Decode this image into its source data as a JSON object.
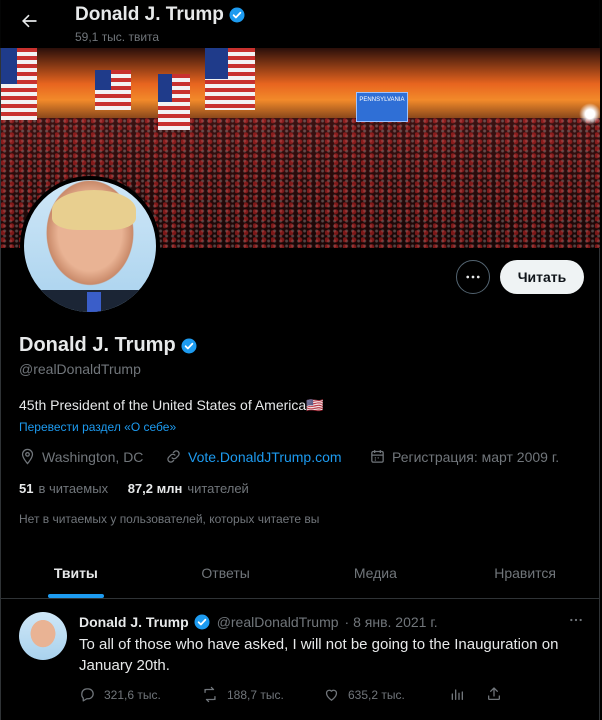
{
  "header": {
    "name": "Donald J. Trump",
    "tweet_count": "59,1 тыс. твита"
  },
  "banner": {
    "screen_text": "PENNSYLVANIA"
  },
  "profile": {
    "name": "Donald J. Trump",
    "handle": "@realDonaldTrump",
    "bio": "45th President of the United States of America🇺🇸",
    "translate_label": "Перевести раздел «О себе»",
    "location": "Washington, DC",
    "website": "Vote.DonaldJTrump.com",
    "joined": "Регистрация: март 2009 г.",
    "following_count": "51",
    "following_label": "в читаемых",
    "followers_count": "87,2 млн",
    "followers_label": "читателей",
    "mutual_note": "Нет в читаемых у пользователей, которых читаете вы",
    "follow_button": "Читать"
  },
  "tabs": [
    {
      "label": "Твиты",
      "active": true
    },
    {
      "label": "Ответы",
      "active": false
    },
    {
      "label": "Медиа",
      "active": false
    },
    {
      "label": "Нравится",
      "active": false
    }
  ],
  "tweet": {
    "name": "Donald J. Trump",
    "handle": "@realDonaldTrump",
    "date": "· 8 янв. 2021 г.",
    "text": "To all of those who have asked, I will not be going to the Inauguration on January 20th.",
    "replies": "321,6 тыс.",
    "retweets": "188,7 тыс.",
    "likes": "635,2 тыс."
  },
  "colors": {
    "accent": "#1d9bf0",
    "background": "#000000",
    "secondary_text": "#71767b"
  }
}
